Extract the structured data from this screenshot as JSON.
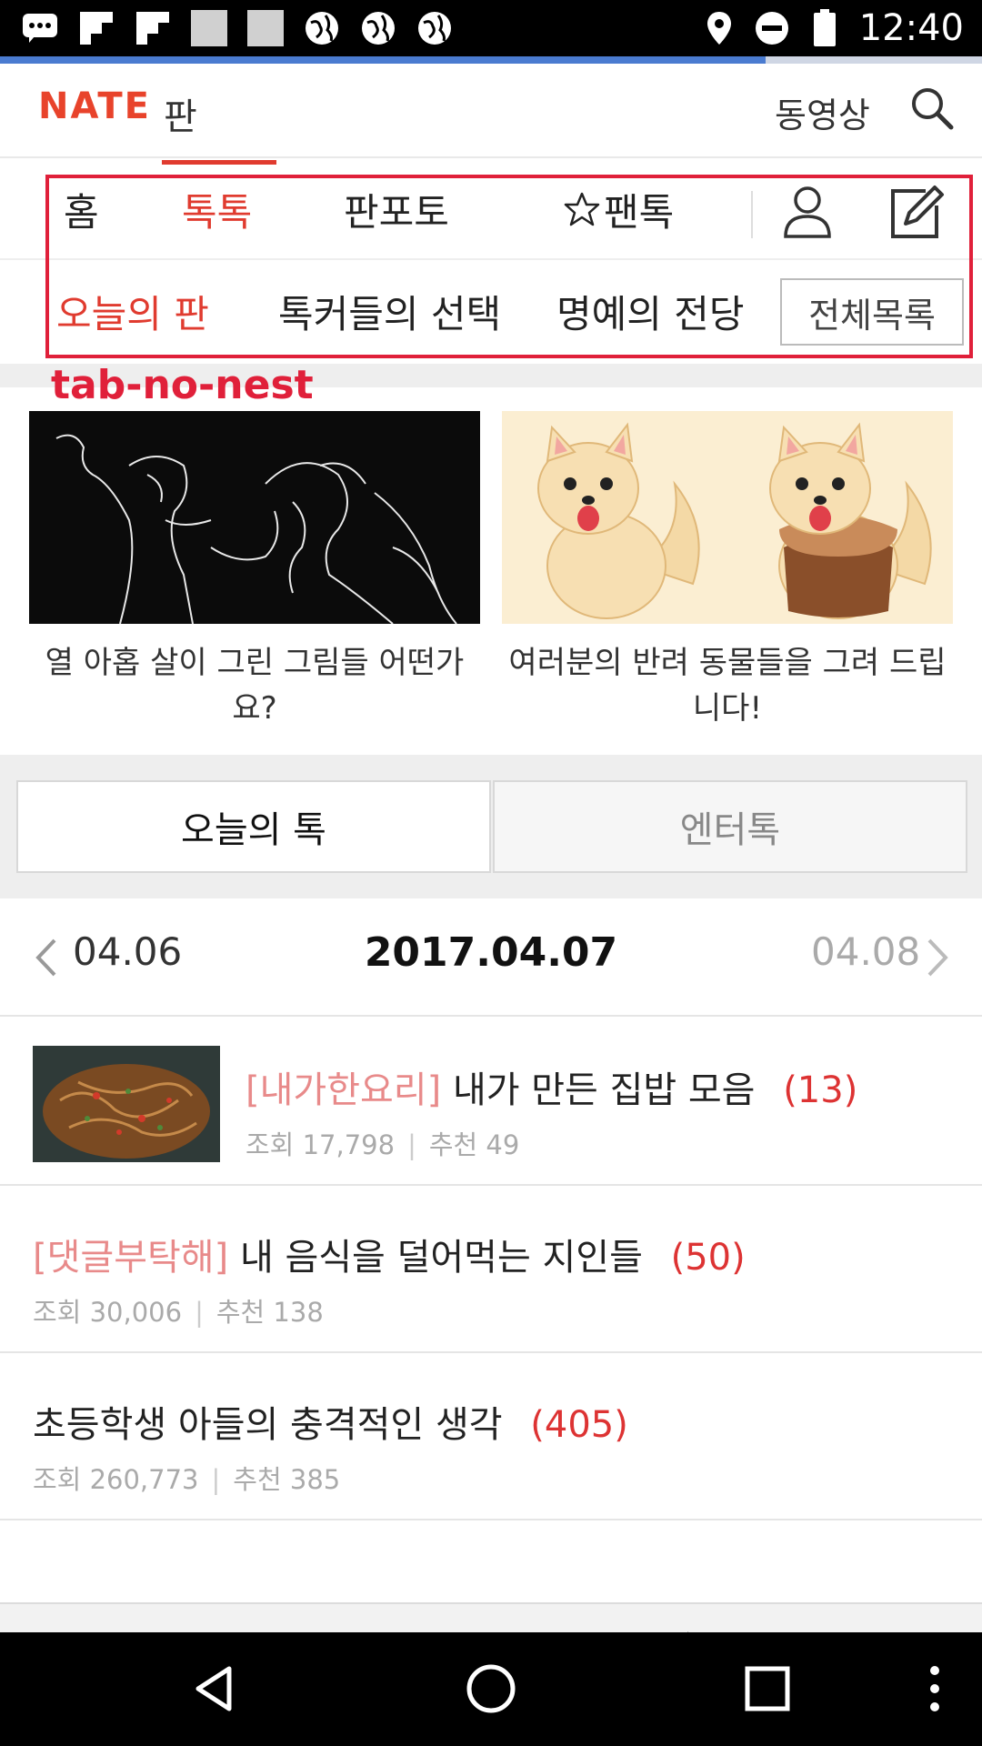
{
  "status_bar": {
    "time": "12:40",
    "left_icons": [
      "chat-icon",
      "flipboard-icon",
      "flipboard-icon",
      "placeholder-icon",
      "placeholder-icon",
      "globe-icon",
      "globe-icon",
      "globe-icon"
    ],
    "right_icons": [
      "location-icon",
      "do-not-disturb-icon",
      "battery-icon"
    ]
  },
  "page_load_progress": 0.78,
  "header": {
    "logo": "NATE",
    "logo_sub": "판",
    "video_label": "동영상",
    "search_icon": "search-icon"
  },
  "tabs": [
    {
      "label": "홈",
      "active": false
    },
    {
      "label": "톡톡",
      "active": true
    },
    {
      "label": "판포토",
      "active": false
    },
    {
      "label": "팬톡",
      "active": false,
      "icon": "star-icon"
    }
  ],
  "tab_icons": [
    "user-icon",
    "edit-icon"
  ],
  "subtabs": [
    {
      "label": "오늘의 판",
      "active": true
    },
    {
      "label": "톡커들의 선택",
      "active": false
    },
    {
      "label": "명예의 전당",
      "active": false
    }
  ],
  "all_list_button": "전체목록",
  "annotation_label": "tab-no-nest",
  "cards": [
    {
      "caption_line1": "열 아홉 살이 그린 그림들 어떤가",
      "caption_line2": "요?"
    },
    {
      "caption_line1": "여러분의 반려 동물들을 그려 드립",
      "caption_line2": "니다!"
    }
  ],
  "segment": {
    "left": "오늘의 톡",
    "right": "엔터톡"
  },
  "date_nav": {
    "prev": "04.06",
    "current": "2017.04.07",
    "next": "04.08"
  },
  "posts": [
    {
      "tag": "[내가한요리]",
      "title": "내가 만든 집밥 모음",
      "count": "(13)",
      "views": "조회 17,798",
      "likes": "추천 49"
    },
    {
      "tag": "[댓글부탁해]",
      "title": "내 음식을 덜어먹는 지인들",
      "count": "(50)",
      "views": "조회 30,006",
      "likes": "추천 138"
    },
    {
      "tag": "",
      "title": "초등학생 아들의 충격적인 생각",
      "count": "(405)",
      "views": "조회 260,773",
      "likes": "추천 385"
    }
  ],
  "browser_bar": [
    "back-icon",
    "forward-icon",
    "more-icon",
    "refresh-icon",
    "close-icon"
  ],
  "nav_bar": [
    "nav-back-icon",
    "nav-home-icon",
    "nav-recents-icon",
    "nav-menu-icon"
  ]
}
